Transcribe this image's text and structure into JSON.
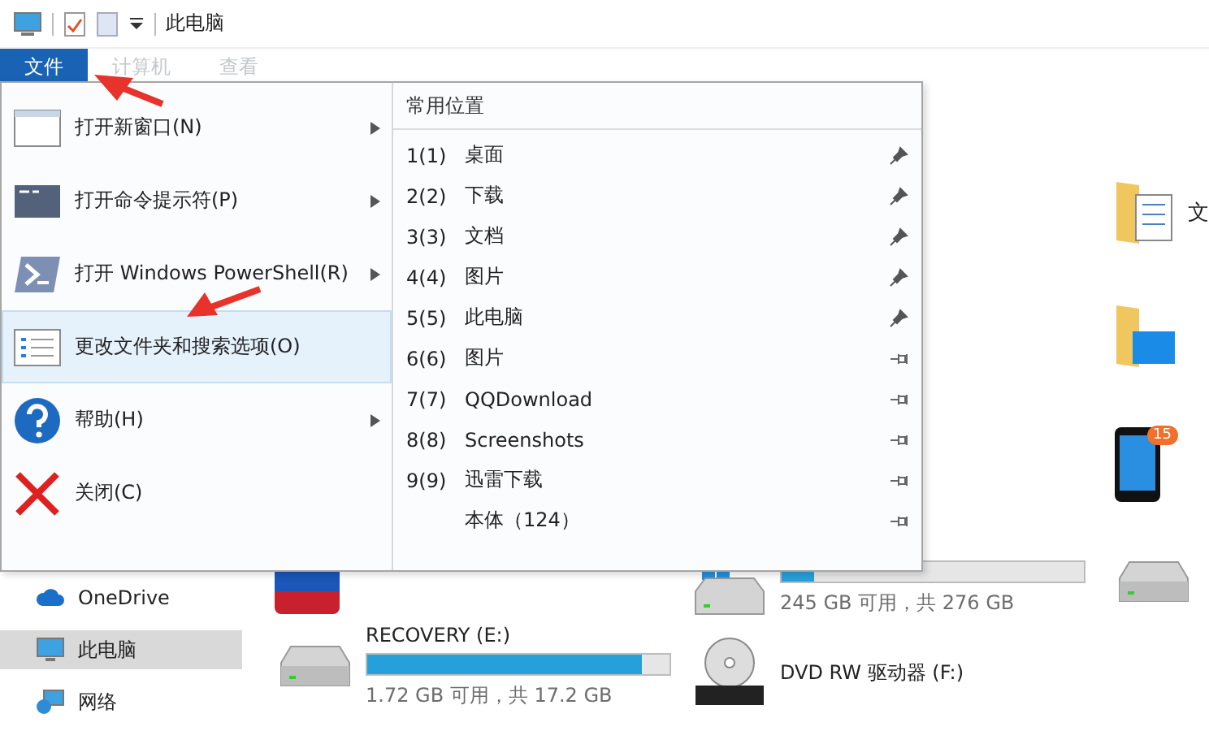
{
  "window": {
    "title": "此电脑"
  },
  "ribbon_tabs": [
    {
      "label": "文件",
      "selected": true
    },
    {
      "label": "计算机",
      "selected": false
    },
    {
      "label": "查看",
      "selected": false
    }
  ],
  "file_menu": {
    "items": [
      {
        "kind": "window",
        "label": "打开新窗口(N)",
        "submenu": true,
        "selected": false
      },
      {
        "kind": "cmd",
        "label": "打开命令提示符(P)",
        "submenu": true,
        "selected": false
      },
      {
        "kind": "powershell",
        "label": "打开 Windows PowerShell(R)",
        "submenu": true,
        "selected": false
      },
      {
        "kind": "options",
        "label": "更改文件夹和搜索选项(O)",
        "submenu": false,
        "selected": true
      },
      {
        "kind": "help",
        "label": "帮助(H)",
        "submenu": true,
        "selected": false
      },
      {
        "kind": "close",
        "label": "关闭(C)",
        "submenu": false,
        "selected": false
      }
    ],
    "frequent_places": {
      "title": "常用位置",
      "items": [
        {
          "number": "1(1)",
          "label": "桌面",
          "pinned": true
        },
        {
          "number": "2(2)",
          "label": "下载",
          "pinned": true
        },
        {
          "number": "3(3)",
          "label": "文档",
          "pinned": true
        },
        {
          "number": "4(4)",
          "label": "图片",
          "pinned": true
        },
        {
          "number": "5(5)",
          "label": "此电脑",
          "pinned": true
        },
        {
          "number": "6(6)",
          "label": "图片",
          "pinned": false
        },
        {
          "number": "7(7)",
          "label": "QQDownload",
          "pinned": false
        },
        {
          "number": "8(8)",
          "label": "Screenshots",
          "pinned": false
        },
        {
          "number": "9(9)",
          "label": "迅雷下载",
          "pinned": false
        },
        {
          "label": "本体（124）",
          "pinned": false
        }
      ]
    }
  },
  "sidebar": {
    "items": [
      {
        "kind": "cloud",
        "label": "OneDrive",
        "selected": false
      },
      {
        "kind": "computer",
        "label": "此电脑",
        "selected": true
      },
      {
        "kind": "network",
        "label": "网络",
        "selected": false
      }
    ]
  },
  "drives": [
    {
      "kind": "hdd",
      "name": "RECOVERY (E:)",
      "level": 0.91,
      "free": "1.72 GB 可用，共 17.2 GB"
    },
    {
      "kind": "windows",
      "level": 0.11,
      "free": "245 GB 可用，共 276 GB"
    },
    {
      "kind": "dvd",
      "name": "DVD RW 驱动器 (F:)"
    }
  ],
  "right_items": [
    {
      "kind": "doc-folder",
      "label": "文"
    },
    {
      "kind": "desktop-folder"
    },
    {
      "kind": "phone",
      "badge": "15"
    },
    {
      "kind": "hdd"
    }
  ]
}
